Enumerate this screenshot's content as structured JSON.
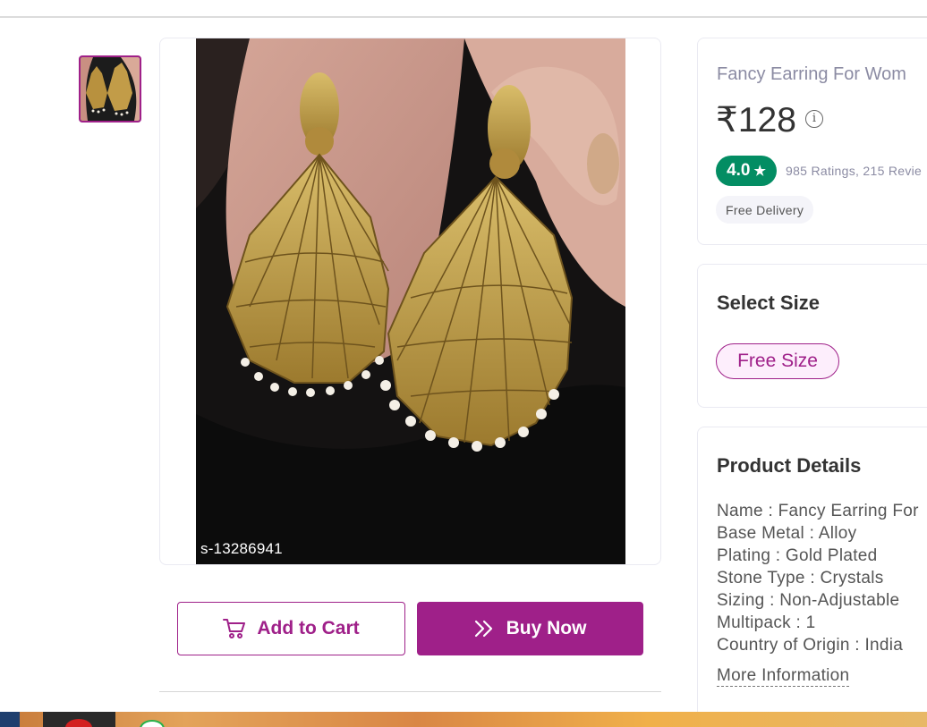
{
  "product": {
    "title": "Fancy Earring For Wom",
    "price": "₹128",
    "info_icon": "i",
    "rating": "4.0",
    "rating_star": "★",
    "rating_text": "985 Ratings, 215 Revie",
    "delivery": "Free Delivery",
    "image_sku": "s-13286941"
  },
  "actions": {
    "add_to_cart": "Add to Cart",
    "buy_now": "Buy Now"
  },
  "size": {
    "heading": "Select Size",
    "selected": "Free Size"
  },
  "details": {
    "heading": "Product Details",
    "lines": [
      "Name : Fancy Earring For",
      "Base Metal : Alloy",
      "Plating : Gold Plated",
      "Stone Type : Crystals",
      "Sizing : Non-Adjustable",
      "Multipack : 1",
      "Country of Origin : India"
    ],
    "more": "More Information"
  },
  "colors": {
    "brand": "#9f2089",
    "rating_green": "#038d63",
    "muted_text": "#8b8ba3"
  },
  "icons": [
    "cart-icon",
    "double-chevron-icon",
    "star-icon",
    "info-icon"
  ]
}
